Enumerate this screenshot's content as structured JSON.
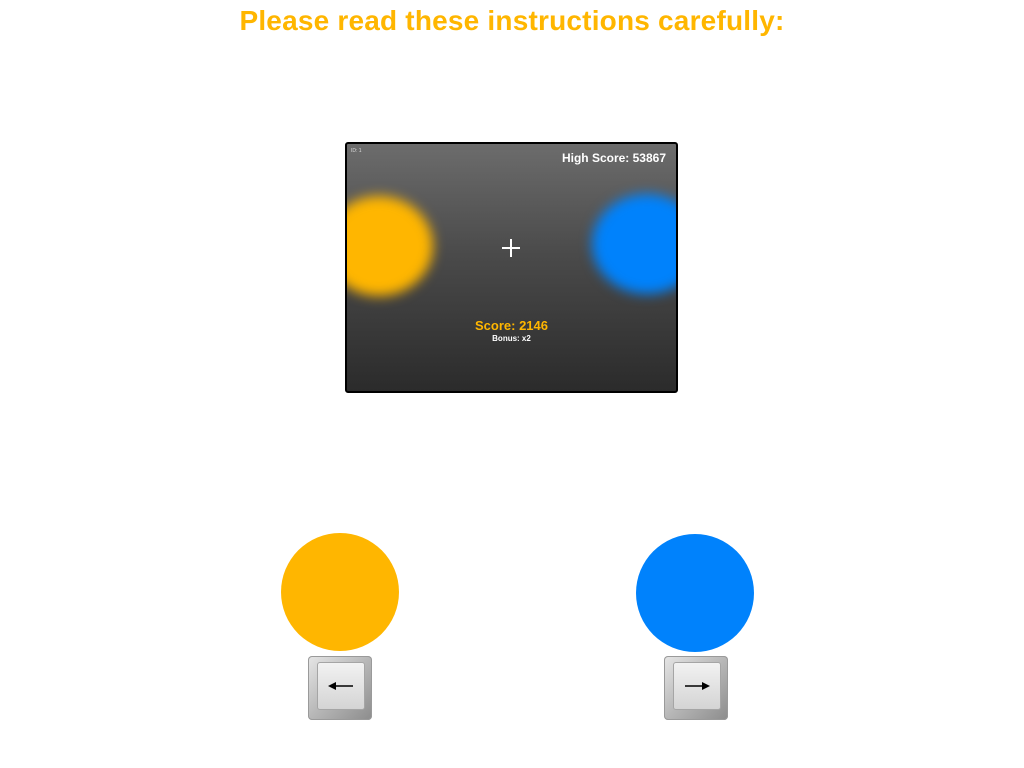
{
  "instructions": {
    "title": "Please read these instructions carefully:"
  },
  "game": {
    "id_label": "ID: 1",
    "high_score_label": "High Score: 53867",
    "score_label": "Score: 2146",
    "bonus_label": "Bonus: x2",
    "left_target_color": "#FFB600",
    "right_target_color": "#0082FC",
    "fixation_icon": "crosshair-icon"
  },
  "response_mapping": {
    "left": {
      "color": "#FFB600",
      "key_icon": "left-arrow-key-icon"
    },
    "right": {
      "color": "#0082FC",
      "key_icon": "right-arrow-key-icon"
    }
  }
}
